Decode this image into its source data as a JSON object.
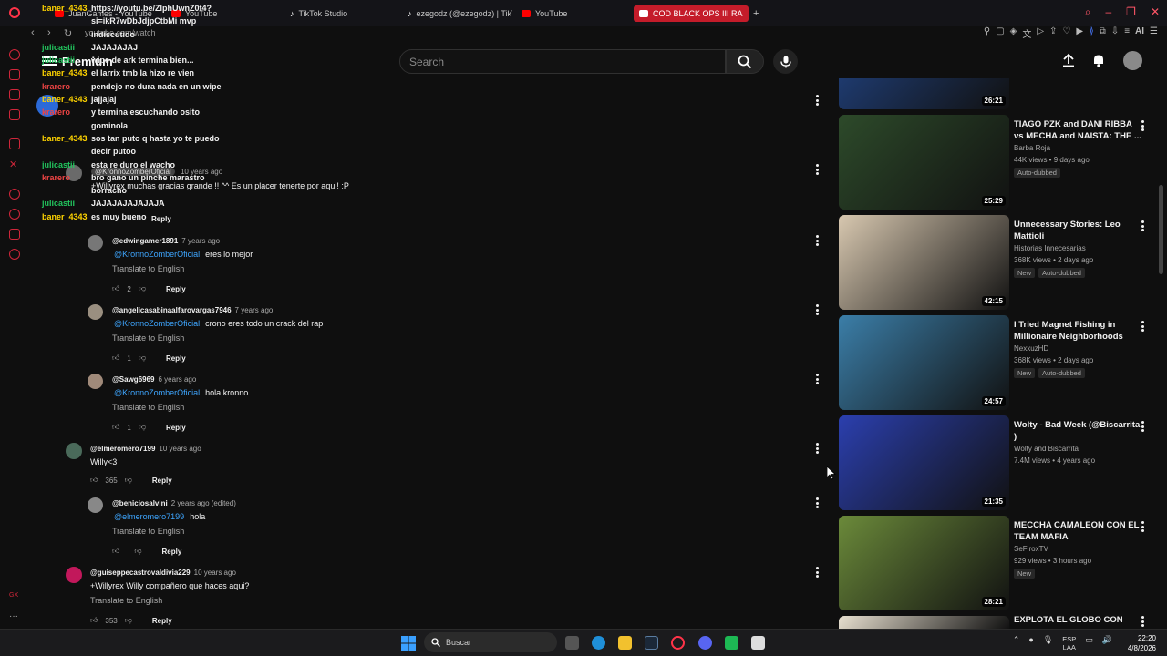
{
  "browser": {
    "tabs": [
      {
        "label": "JuanGames - YouTube"
      },
      {
        "label": "YouTube"
      },
      {
        "label": "TikTok Studio"
      },
      {
        "label": "ezegodz (@ezegodz) | TikTok"
      },
      {
        "label": "YouTube"
      },
      {
        "label": "COD BLACK OPS III RA"
      }
    ],
    "url": "youtube.com/watch",
    "new_tab": "+"
  },
  "youtube": {
    "logo": "Premium",
    "search_placeholder": "Search"
  },
  "chat": [
    {
      "user": "baner_4343",
      "color": "#ffd400",
      "text": "https://youtu.be/ZlphUwnZ0t4?"
    },
    {
      "user": "",
      "color": "#ffd400",
      "text": "si=ikR7wDbJdjpCtbMi mvp"
    },
    {
      "user": "",
      "color": "#ffd400",
      "text": "indiscutido"
    },
    {
      "user": "julicastii",
      "color": "#22c55e",
      "text": "JAJAJAJAJ"
    },
    {
      "user": "julicastii",
      "color": "#22c55e",
      "text": "wipe de ark termina bien..."
    },
    {
      "user": "baner_4343",
      "color": "#ffd400",
      "text": "el larrix tmb la hizo re vien"
    },
    {
      "user": "krarero",
      "color": "#ef4444",
      "text": "pendejo no dura nada en un wipe"
    },
    {
      "user": "baner_4343",
      "color": "#ffd400",
      "text": "jajjajaj"
    },
    {
      "user": "krarero",
      "color": "#ef4444",
      "text": "y termina escuchando osito"
    },
    {
      "user": "",
      "color": "#ef4444",
      "text": "gominola"
    },
    {
      "user": "baner_4343",
      "color": "#ffd400",
      "text": "sos tan puto q hasta yo te puedo"
    },
    {
      "user": "",
      "color": "#ffd400",
      "text": "decir putoo"
    },
    {
      "user": "julicastii",
      "color": "#22c55e",
      "text": "esta re duro el wacho"
    },
    {
      "user": "krarero",
      "color": "#ef4444",
      "text": "bro gano un pinche marastro"
    },
    {
      "user": "",
      "color": "#ef4444",
      "text": "borracho"
    },
    {
      "user": "julicastii",
      "color": "#22c55e",
      "text": "JAJAJAJAJAJAJA"
    },
    {
      "user": "baner_4343",
      "color": "#ffd400",
      "text": "es muy bueno"
    }
  ],
  "top_comment": {
    "user": "@KronnoZomberOficial",
    "time": "10 years ago",
    "text": "+Willyrex muchas gracias grande !! ^^ Es un placer tenerte por aqui! :P",
    "reply": "Reply"
  },
  "comments": [
    {
      "user": "@edwingamer1891",
      "time": "7 years ago",
      "mention": "@KronnoZomberOficial",
      "text": "eres lo mejor",
      "translate": "Translate to English",
      "likes": "2",
      "reply": "Reply"
    },
    {
      "user": "@angelicasabinaalfarovargas7946",
      "time": "7 years ago",
      "mention": "@KronnoZomberOficial",
      "text": "crono eres todo un crack del rap",
      "translate": "Translate to English",
      "likes": "1",
      "reply": "Reply"
    },
    {
      "user": "@Sawg6969",
      "time": "6 years ago",
      "mention": "@KronnoZomberOficial",
      "text": "hola kronno",
      "translate": "Translate to English",
      "likes": "1",
      "reply": "Reply"
    },
    {
      "user": "@elmeromero7199",
      "time": "10 years ago",
      "mention": "",
      "text": "Willy<3",
      "translate": "",
      "likes": "365",
      "reply": "Reply"
    },
    {
      "user": "@beniciosalvini",
      "time": "2 years ago (edited)",
      "mention": "@elmeromero7199",
      "text": "hola",
      "translate": "Translate to English",
      "likes": "",
      "reply": "Reply"
    },
    {
      "user": "@guiseppecastrovaldivia229",
      "time": "10 years ago",
      "mention": "",
      "text": "+Willyrex Willy compañero que haces aqui?",
      "translate": "Translate to English",
      "likes": "353",
      "reply": "Reply"
    }
  ],
  "recommendations": [
    {
      "title": "",
      "channel": "",
      "stats": "",
      "badges": [],
      "duration": "26:21",
      "thumb_color": "#1e3a6e"
    },
    {
      "title": "TIAGO PZK and DANI RIBBA vs MECHA and NAISTA: THE ...",
      "channel": "Barba Roja",
      "stats": "44K views • 9 days ago",
      "badges": [
        "Auto-dubbed"
      ],
      "duration": "25:29",
      "thumb_color": "#2d4a2a"
    },
    {
      "title": "Unnecessary Stories: Leo Mattioli",
      "channel": "Historias Innecesarias",
      "stats": "368K views • 2 days ago",
      "badges": [
        "New",
        "Auto-dubbed"
      ],
      "duration": "42:15",
      "thumb_color": "#d8c8b0"
    },
    {
      "title": "I Tried Magnet Fishing in Millionaire Neighborhoods",
      "channel": "NexxuzHD",
      "stats": "368K views • 2 days ago",
      "badges": [
        "New",
        "Auto-dubbed"
      ],
      "duration": "24:57",
      "thumb_color": "#3b7ea8"
    },
    {
      "title": "Wolty - Bad Week (@Biscarrita )",
      "channel": "Wolty and Biscarrita",
      "stats": "7.4M views • 4 years ago",
      "badges": [],
      "duration": "21:35",
      "thumb_color": "#2b3fae"
    },
    {
      "title": "MECCHA CAMALEON CON EL TEAM MAFIA",
      "channel": "SeFiroxTV",
      "stats": "929 views • 3 hours ago",
      "badges": [
        "New"
      ],
      "duration": "28:21",
      "thumb_color": "#6b8a3a"
    },
    {
      "title": "EXPLOTA EL GLOBO CON",
      "channel": "",
      "stats": "",
      "badges": [],
      "duration": "",
      "thumb_color": "#e8e0d0"
    }
  ],
  "taskbar": {
    "search_label": "Buscar",
    "lang": "ESP",
    "lang2": "LAA",
    "time": "22:20",
    "date": "4/8/2026"
  }
}
